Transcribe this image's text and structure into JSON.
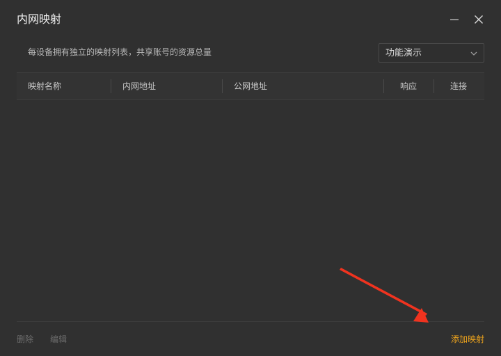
{
  "window": {
    "title": "内网映射",
    "minimize_icon": "minimize-icon",
    "close_icon": "close-icon"
  },
  "header": {
    "description": "每设备拥有独立的映射列表，共享账号的资源总量",
    "select": {
      "value": "功能演示",
      "icon": "chevron-down-icon"
    }
  },
  "table": {
    "columns": [
      "映射名称",
      "内网地址",
      "公网地址",
      "响应",
      "连接"
    ],
    "rows": []
  },
  "footer": {
    "delete_label": "删除",
    "edit_label": "编辑",
    "add_label": "添加映射"
  },
  "colors": {
    "background": "#303030",
    "accent": "#f0a51c",
    "annotation_arrow": "#f0331f",
    "disabled_text": "#6c6c6c"
  }
}
